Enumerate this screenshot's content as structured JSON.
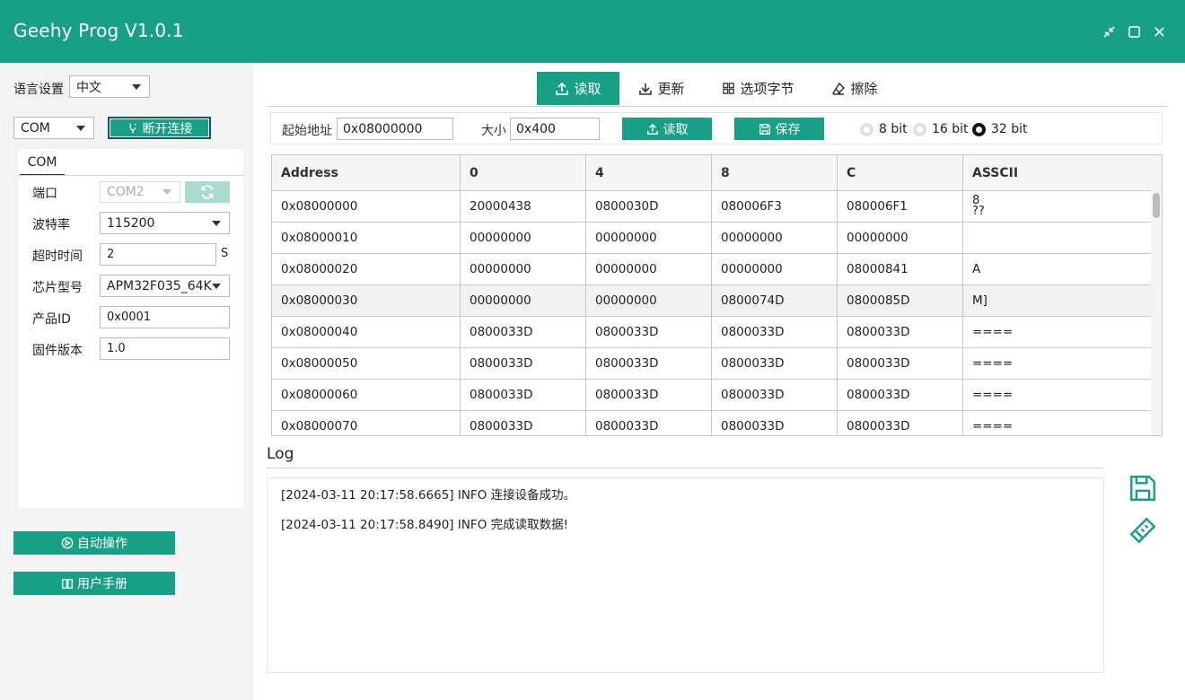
{
  "window": {
    "title": "Geehy Prog V1.0.1"
  },
  "sidebar": {
    "language_label": "语言设置",
    "language_value": "中文",
    "connection_type": "COM",
    "disconnect_label": "断开连接",
    "panel_tab": "COM",
    "port_label": "端口",
    "port_value": "COM2",
    "baud_label": "波特率",
    "baud_value": "115200",
    "timeout_label": "超时时间",
    "timeout_value": "2",
    "timeout_unit": "S",
    "chip_label": "芯片型号",
    "chip_value": "APM32F035_64K",
    "product_label": "产品ID",
    "product_value": "0x0001",
    "firmware_label": "固件版本",
    "firmware_value": "1.0",
    "auto_label": "自动操作",
    "manual_label": "用户手册"
  },
  "tabs": [
    {
      "label": "读取",
      "icon": "upload-icon",
      "active": true
    },
    {
      "label": "更新",
      "icon": "download-icon",
      "active": false
    },
    {
      "label": "选项字节",
      "icon": "grid-icon",
      "active": false
    },
    {
      "label": "擦除",
      "icon": "eraser-icon",
      "active": false
    }
  ],
  "toolbar": {
    "start_label": "起始地址",
    "start_value": "0x08000000",
    "size_label": "大小",
    "size_value": "0x400",
    "read_label": "读取",
    "save_label": "保存",
    "radios": [
      {
        "label": "8 bit",
        "checked": false
      },
      {
        "label": "16 bit",
        "checked": false
      },
      {
        "label": "32 bit",
        "checked": true
      }
    ]
  },
  "table": {
    "headers": [
      "Address",
      "0",
      "4",
      "8",
      "C",
      "ASSCII"
    ],
    "rows": [
      [
        "0x08000000",
        "20000438",
        "0800030D",
        "080006F3",
        "080006F1",
        "8\n??"
      ],
      [
        "0x08000010",
        "00000000",
        "00000000",
        "00000000",
        "00000000",
        ""
      ],
      [
        "0x08000020",
        "00000000",
        "00000000",
        "00000000",
        "08000841",
        "A"
      ],
      [
        "0x08000030",
        "00000000",
        "00000000",
        "0800074D",
        "0800085D",
        "M]"
      ],
      [
        "0x08000040",
        "0800033D",
        "0800033D",
        "0800033D",
        "0800033D",
        "===="
      ],
      [
        "0x08000050",
        "0800033D",
        "0800033D",
        "0800033D",
        "0800033D",
        "===="
      ],
      [
        "0x08000060",
        "0800033D",
        "0800033D",
        "0800033D",
        "0800033D",
        "===="
      ],
      [
        "0x08000070",
        "0800033D",
        "0800033D",
        "0800033D",
        "0800033D",
        "===="
      ]
    ]
  },
  "log": {
    "title": "Log",
    "entries": [
      "[2024-03-11 20:17:58.6665] INFO 连接设备成功。",
      "[2024-03-11 20:17:58.8490] INFO 完成读取数据!"
    ]
  },
  "colors": {
    "accent": "#17a085",
    "accent_dark": "#0d5f4f",
    "accent_light": "#a9dccf"
  }
}
